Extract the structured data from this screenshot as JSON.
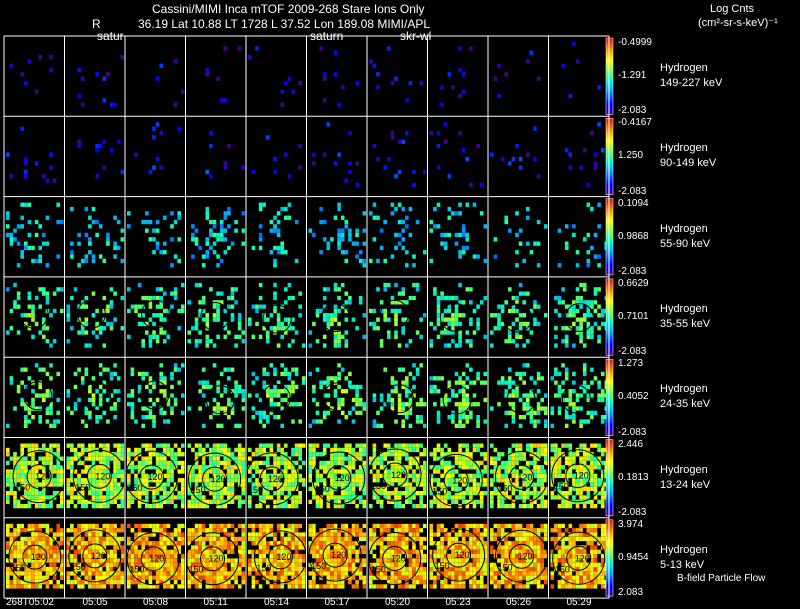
{
  "header": {
    "title": "Cassini/MIMI Inca mTOF  2009-268   Stare    Ions Only",
    "line2_r": "R",
    "line2_rest": "36.19 Lat 10.88 LT 1728 L         37.52 Lon          189.08  MIMI/APL",
    "sub1": "satur",
    "sub2": "saturn",
    "sub3": "skr-wl",
    "units_title": "Log Cnts",
    "units_sub": "(cm²-sr-s-keV)⁻¹"
  },
  "footer_label": "B-field Particle Flow",
  "time_labels": [
    "268T05:02",
    "05:05",
    "05:08",
    "05:11",
    "05:14",
    "05:17",
    "05:20",
    "05:23",
    "05:26",
    "05:29"
  ],
  "colors": {
    "background": "#000000",
    "grid_line": "#ffffff",
    "contour": "#000000"
  },
  "chart_data": {
    "type": "heatmap",
    "columns": 10,
    "rows": [
      {
        "species": "Hydrogen",
        "energy": "149-227 keV",
        "cb_top": "-0.4999",
        "cb_mid": "-1.291",
        "cb_bot": "-2.083",
        "level": 0.05,
        "density": 0.05,
        "contours": false
      },
      {
        "species": "Hydrogen",
        "energy": "90-149 keV",
        "cb_top": "-0.4167",
        "cb_mid": "1.250",
        "cb_bot": "-2.083",
        "level": 0.08,
        "density": 0.07,
        "contours": false
      },
      {
        "species": "Hydrogen",
        "energy": "55-90 keV",
        "cb_top": "0.1094",
        "cb_mid": "0.9868",
        "cb_bot": "-2.083",
        "level": 0.35,
        "density": 0.25,
        "contours": false
      },
      {
        "species": "Hydrogen",
        "energy": "35-55 keV",
        "cb_top": "0.6629",
        "cb_mid": "0.7101",
        "cb_bot": "-2.083",
        "level": 0.42,
        "density": 0.35,
        "contours": true
      },
      {
        "species": "Hydrogen",
        "energy": "24-35 keV",
        "cb_top": "1.273",
        "cb_mid": "0.4052",
        "cb_bot": "-2.083",
        "level": 0.45,
        "density": 0.4,
        "contours": true
      },
      {
        "species": "Hydrogen",
        "energy": "13-24 keV",
        "cb_top": "2.446",
        "cb_mid": "0.1813",
        "cb_bot": "-2.083",
        "level": 0.62,
        "density": 0.8,
        "contours": true
      },
      {
        "species": "Hydrogen",
        "energy": "5-13 keV",
        "cb_top": "3.974",
        "cb_mid": "0.9454",
        "cb_bot": "2.083",
        "level": 0.78,
        "density": 0.92,
        "contours": true
      }
    ],
    "contour_labels": [
      "120",
      "150"
    ]
  }
}
